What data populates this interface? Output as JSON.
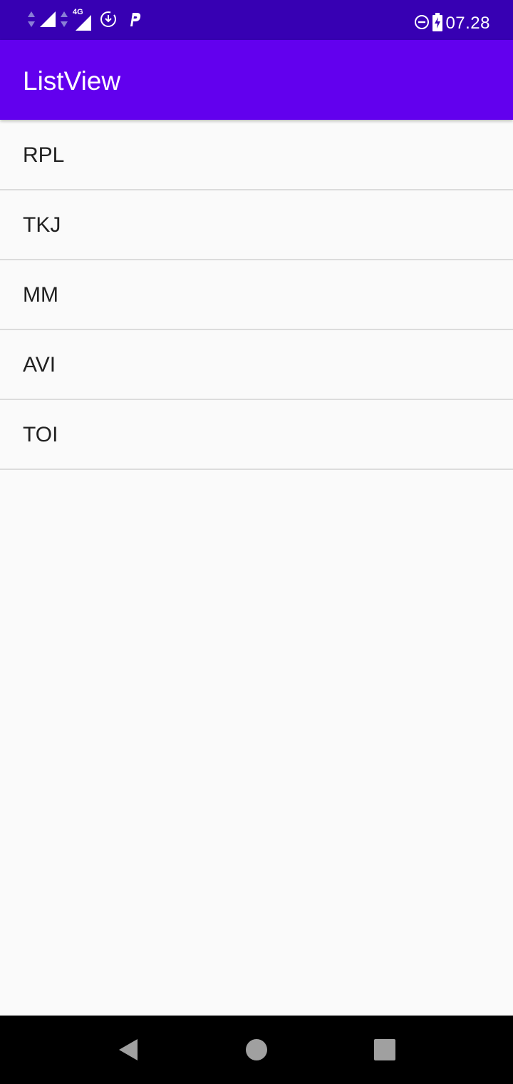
{
  "status_bar": {
    "time": "07.28",
    "network_label": "4G",
    "icons_left": [
      "data-arrows-icon",
      "signal-icon",
      "data-arrows-icon",
      "signal-4g-icon",
      "download-icon",
      "parking-p-icon"
    ],
    "icons_right": [
      "do-not-disturb-icon",
      "battery-charging-icon"
    ]
  },
  "app_bar": {
    "title": "ListView"
  },
  "list": {
    "items": [
      {
        "label": "RPL"
      },
      {
        "label": "TKJ"
      },
      {
        "label": "MM"
      },
      {
        "label": "AVI"
      },
      {
        "label": "TOI"
      }
    ]
  },
  "nav_bar": {
    "buttons": [
      "back-icon",
      "home-icon",
      "recents-icon"
    ]
  },
  "colors": {
    "status_bar": "#3700b3",
    "app_bar": "#6200ee",
    "background": "#fafafa",
    "divider": "#dcdcdc",
    "text": "#212121"
  }
}
